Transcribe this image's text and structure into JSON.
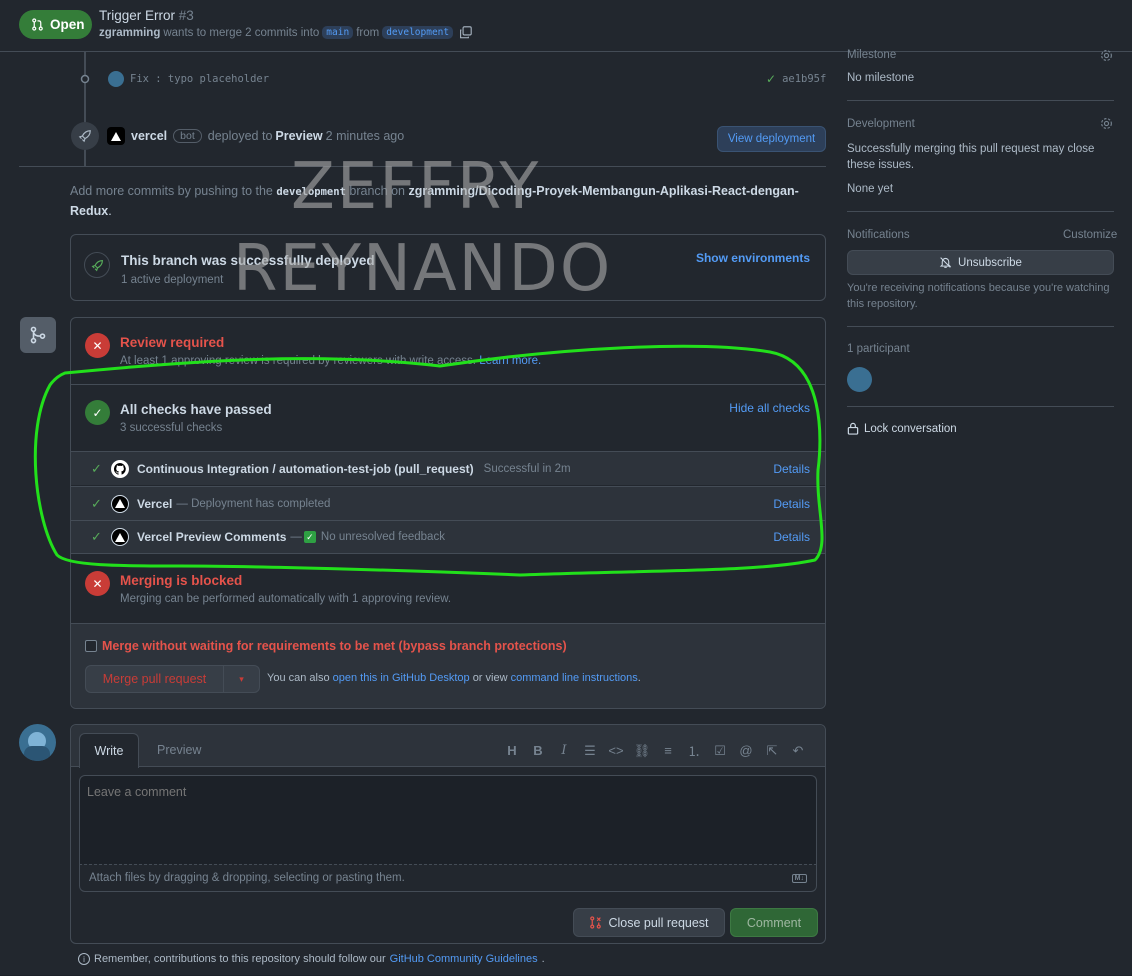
{
  "header": {
    "status": "Open",
    "title": "Trigger Error",
    "number": "#3",
    "author": "zgramming",
    "merge_text": "wants to merge 2 commits into",
    "base_branch": "main",
    "from_text": "from",
    "head_branch": "development"
  },
  "commit": {
    "message": "Fix : typo placeholder",
    "sha": "ae1b95f"
  },
  "deploy_event": {
    "actor": "vercel",
    "bot_badge": "bot",
    "deployed_to": "deployed to",
    "environment": "Preview",
    "time": "2 minutes ago",
    "view_button": "View deployment"
  },
  "push_hint": {
    "prefix": "Add more commits by pushing to the",
    "branch": "development",
    "middle": "branch on",
    "repo": "zgramming/Dicoding-Proyek-Membangun-Aplikasi-React-dengan-Redux",
    "suffix": "."
  },
  "deployments": {
    "title": "This branch was successfully deployed",
    "subtitle": "1 active deployment",
    "link": "Show environments"
  },
  "review": {
    "title": "Review required",
    "text": "At least 1 approving review is required by reviewers with write access.",
    "link": "Learn more."
  },
  "checks": {
    "title": "All checks have passed",
    "subtitle": "3 successful checks",
    "toggle": "Hide all checks",
    "items": [
      {
        "name": "Continuous Integration / automation-test-job (pull_request)",
        "status": "Successful in 2m",
        "link": "Details"
      },
      {
        "name": "Vercel",
        "status": "— Deployment has completed",
        "link": "Details"
      },
      {
        "name": "Vercel Preview Comments",
        "status": "— ",
        "status2": "No unresolved feedback",
        "link": "Details"
      }
    ]
  },
  "merge": {
    "blocked_title": "Merging is blocked",
    "blocked_text": "Merging can be performed automatically with 1 approving review.",
    "bypass_label": "Merge without waiting for requirements to be met (bypass branch protections)",
    "merge_button": "Merge pull request",
    "also_text": "You can also",
    "desktop_link": "open this in GitHub Desktop",
    "or_view": "or view",
    "cli_link": "command line instructions",
    "period": "."
  },
  "composer": {
    "tab_write": "Write",
    "tab_preview": "Preview",
    "placeholder": "Leave a comment",
    "attach_hint": "Attach files by dragging & dropping, selecting or pasting them.",
    "close_button": "Close pull request",
    "comment_button": "Comment",
    "guidelines_prefix": "Remember, contributions to this repository should follow our",
    "guidelines_link": "GitHub Community Guidelines",
    "guidelines_suffix": "."
  },
  "sidebar": {
    "milestone_label": "Milestone",
    "milestone_value": "No milestone",
    "development_label": "Development",
    "development_text": "Successfully merging this pull request may close these issues.",
    "development_value": "None yet",
    "notifications_label": "Notifications",
    "customize": "Customize",
    "unsubscribe": "Unsubscribe",
    "notifications_text": "You're receiving notifications because you're watching this repository.",
    "participants": "1 participant",
    "lock": "Lock conversation"
  },
  "watermark": {
    "line1": "ZEFFRY",
    "line2": "REYNANDO"
  },
  "colors": {
    "background": "#22272e",
    "accent_blue": "#539bf5",
    "success_green": "#347d39",
    "danger_red": "#e5534b",
    "annotation_green": "#22e01b"
  }
}
